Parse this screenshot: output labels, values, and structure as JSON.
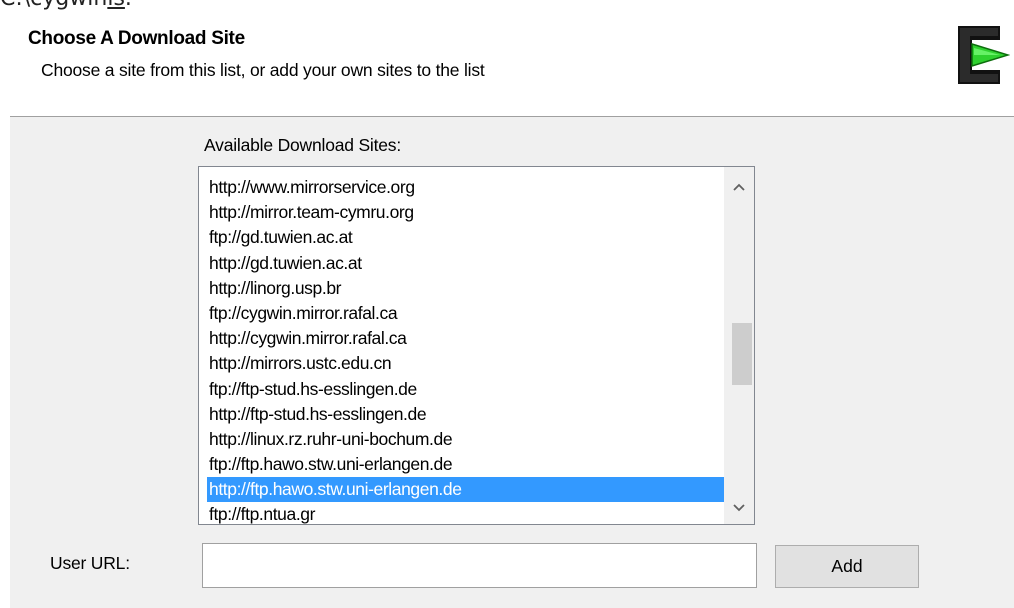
{
  "background_path": {
    "prefix": "C:\\cygwin",
    "underlined": "ls",
    "suffix": "."
  },
  "header": {
    "title": "Choose A Download Site",
    "subtitle": "Choose a site from this list, or add your own sites to the list",
    "logo_icon": "cygwin-logo-icon"
  },
  "sites": {
    "label": "Available Download Sites:",
    "items": [
      "http://www.mirrorservice.org",
      "http://mirror.team-cymru.org",
      "ftp://gd.tuwien.ac.at",
      "http://gd.tuwien.ac.at",
      "http://linorg.usp.br",
      "ftp://cygwin.mirror.rafal.ca",
      "http://cygwin.mirror.rafal.ca",
      "http://mirrors.ustc.edu.cn",
      "ftp://ftp-stud.hs-esslingen.de",
      "http://ftp-stud.hs-esslingen.de",
      "http://linux.rz.ruhr-uni-bochum.de",
      "ftp://ftp.hawo.stw.uni-erlangen.de",
      "http://ftp.hawo.stw.uni-erlangen.de",
      "ftp://ftp.ntua.gr"
    ],
    "selected_index": 12,
    "selection_color": "#3399ff",
    "scroll_up_icon": "chevron-up-icon",
    "scroll_down_icon": "chevron-down-icon"
  },
  "user_url": {
    "label": "User URL:",
    "value": "",
    "placeholder": ""
  },
  "add_button": {
    "label": "Add"
  }
}
